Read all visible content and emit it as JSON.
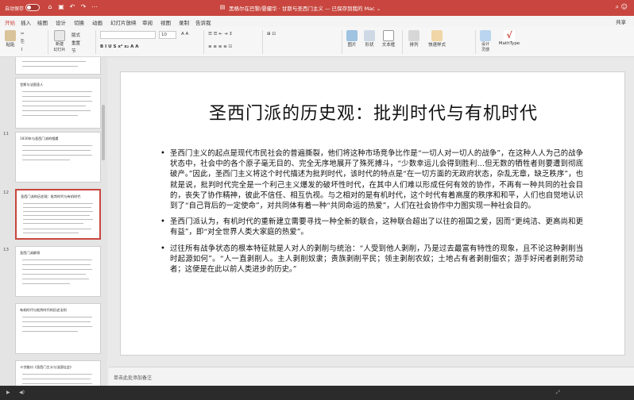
{
  "titlebar": {
    "autosave_label": "自动保存",
    "toggle_state": "关",
    "document_title": "黑格尔在巴黎/晏儼华 · 甘斯与圣西门主义 — 已保存到我的 Mac ⌄"
  },
  "tabs": [
    "开始",
    "插入",
    "绘图",
    "设计",
    "切换",
    "动画",
    "幻灯片放映",
    "审阅",
    "视图",
    "录制",
    "告诉我"
  ],
  "active_tab": "开始",
  "share_label": "共享",
  "ribbon": {
    "paste": "粘贴",
    "layout": "版式",
    "reset": "重置",
    "new_slide": "新建\n幻灯片",
    "section": "节",
    "font_placeholder": "",
    "font_size": "10",
    "picture": "图片",
    "shape": "形状",
    "textbox": "文本框",
    "arrange": "排列",
    "quick_styles": "快速样式",
    "designer": "设计\n灵感",
    "mathtype": "MathType"
  },
  "thumbnails": [
    {
      "num": "",
      "title": ""
    },
    {
      "num": "",
      "title": "甘斯与法国圣人"
    },
    {
      "num": "11",
      "title": "1830年与圣西门派的相遇"
    },
    {
      "num": "12",
      "title": "圣西门派的历史观：批判时代与有机时代"
    },
    {
      "num": "13",
      "title": "圣西门派纲领"
    },
    {
      "num": "",
      "title": "有机时代与批判时代的历史法则"
    },
    {
      "num": "",
      "title": "十字路口《圣西门主义与法国社会》"
    }
  ],
  "selected_thumbnail": 3,
  "slide": {
    "title": "圣西门派的历史观：批判时代与有机时代",
    "bullets": [
      "圣西门主义的起点是现代市民社会的普遍撕裂，他们将这种市场竞争比作是“一切人对一切人的战争”，在这种人人为己的战争状态中，社会中的各个原子毫无目的、完全无序地展开了殊死搏斗，“少数幸运儿会得到胜利…但无数的牺牲者则要遭到彻底破产。”因此，圣西门主义将这个时代描述为批判时代，该时代的特点是“在一切方面的无政府状态，杂乱无章，缺乏秩序”，也就是说，批判时代完全是一个利己主义爆发的破坏性时代，在其中人们难以形成任何有效的协作，不再有一种共同的社会目的，丧失了协作精神，彼此不信任、相互仇视。与之相对的是有机时代，这个时代有着高度的秩序和和平，人们也自觉地认识到了“自己背后的一定使命”，对共同体有着一种“共同命运的热爱”，人们在社会协作中力图实现一种社会目的。",
      "圣西门派认为，有机时代的重新建立需要寻找一种全新的联合，这种联合超出了以往的祖国之爱，因而“更纯洁、更高尚和更有益”，即“对全世界人类大家庭的热爱”。",
      "过往所有战争状态的根本特征就是人对人的剥削与统治：“人受到他人剥削，乃是过去最富有特性的现象，且不论这种剥削当时起源如何”。“人一直剥削人。主人剥削奴隶；贵族剥削平民；领主剥削农奴；土地占有者剥削佃农；游手好闲者剥削劳动者；这便是在此以前人类进步的历史。”"
    ]
  },
  "notes_placeholder": "单击此处添加备注",
  "statusbar": {
    "left": "",
    "right": ""
  },
  "colors": {
    "accent": "#c8463f"
  }
}
